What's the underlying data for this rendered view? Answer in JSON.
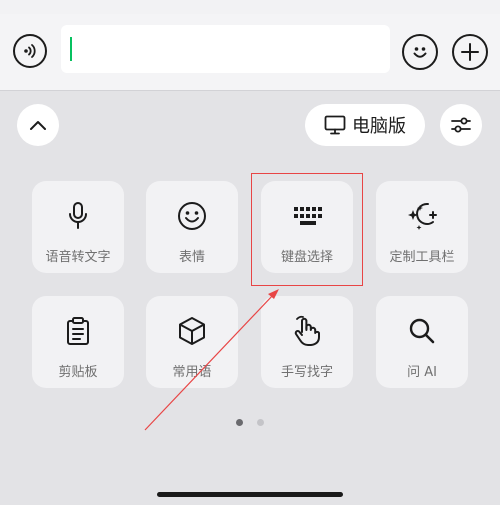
{
  "toolbar": {
    "desktop_label": "电脑版"
  },
  "tiles": [
    {
      "label": "语音转文字",
      "icon": "microphone-icon"
    },
    {
      "label": "表情",
      "icon": "emoji-icon"
    },
    {
      "label": "键盘选择",
      "icon": "keyboard-icon"
    },
    {
      "label": "定制工具栏",
      "icon": "sparkle-plus-icon"
    },
    {
      "label": "剪贴板",
      "icon": "clipboard-icon"
    },
    {
      "label": "常用语",
      "icon": "cube-icon"
    },
    {
      "label": "手写找字",
      "icon": "hand-write-icon"
    },
    {
      "label": "问 AI",
      "icon": "search-icon"
    }
  ],
  "pager": {
    "total": 2,
    "current": 1
  },
  "colors": {
    "caret": "#07c160",
    "highlight": "#e84545"
  }
}
